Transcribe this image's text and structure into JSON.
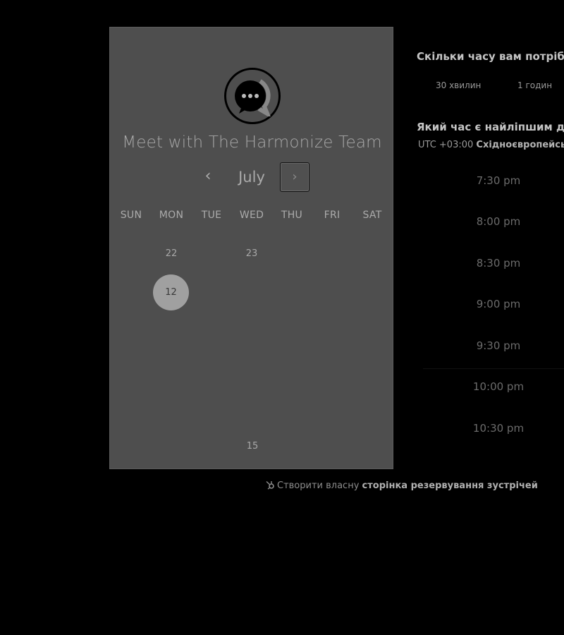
{
  "card": {
    "title": "Meet with The Harmonize Team",
    "month": "July",
    "prev_glyph": "‹",
    "next_glyph": "›",
    "weekdays": [
      "SUN",
      "MON",
      "TUE",
      "WED",
      "THU",
      "FRI",
      "SAT"
    ],
    "days": {
      "row1_mon": "22",
      "row1_wed": "23",
      "selected": "12",
      "bottom_wed": "15"
    }
  },
  "scheduler": {
    "duration_heading": "Скільки часу вам потрібно",
    "duration_options": [
      "30 хвилин",
      "1 годин"
    ],
    "time_heading": "Який час є найліпшим для",
    "timezone_prefix": "UTC +03:00",
    "timezone_name": "Східноєвропейсь",
    "slots": [
      "7:30 pm",
      "8:00 pm",
      "8:30 pm",
      "9:00 pm",
      "9:30 pm",
      "10:00 pm",
      "10:30 pm"
    ]
  },
  "footer": {
    "lead": "Створити власну",
    "link": "сторінка резервування зустрічей"
  },
  "colors": {
    "background": "#000000",
    "card": "#4e4e4e",
    "selected_day": "#a0a0a0"
  }
}
